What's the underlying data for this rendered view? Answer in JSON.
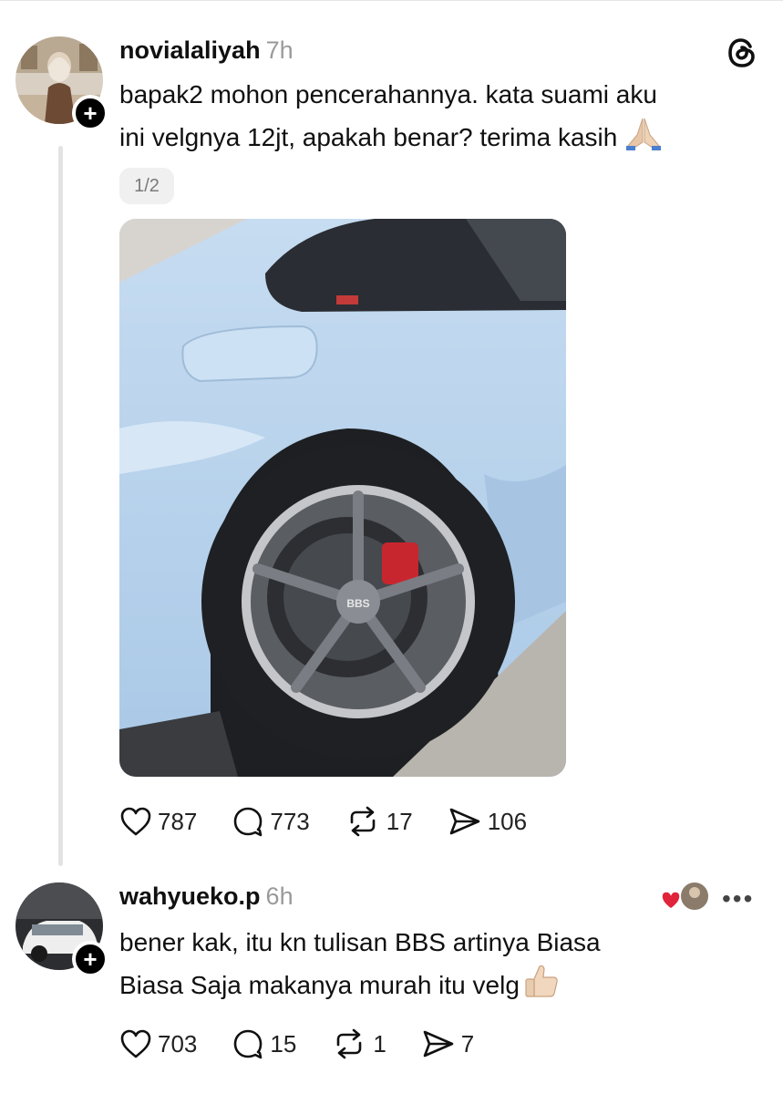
{
  "post": {
    "username": "novialaliyah",
    "time": "7h",
    "text_line1": "bapak2 mohon pencerahannya. kata suami aku",
    "text_line2": "ini velgnya 12jt, apakah benar? terima kasih",
    "pager": "1/2",
    "likes": "787",
    "comments": "773",
    "reposts": "17",
    "shares": "106",
    "icons": [
      "heart-icon",
      "comment-icon",
      "repost-icon",
      "send-icon",
      "threads-logo-icon",
      "praying-hands-emoji"
    ]
  },
  "reply": {
    "username": "wahyueko.p",
    "time": "6h",
    "text_line1": "bener kak, itu kn tulisan BBS artinya Biasa",
    "text_line2": "Biasa Saja makanya murah itu velg",
    "likes": "703",
    "comments": "15",
    "reposts": "1",
    "shares": "7",
    "icons": [
      "heart-icon",
      "comment-icon",
      "repost-icon",
      "send-icon",
      "more-icon",
      "thumbs-up-emoji"
    ]
  },
  "colors": {
    "text": "#101010",
    "muted": "#9a9a9a",
    "thread_line": "#e3e3e3",
    "heart_red": "#e0243b"
  }
}
